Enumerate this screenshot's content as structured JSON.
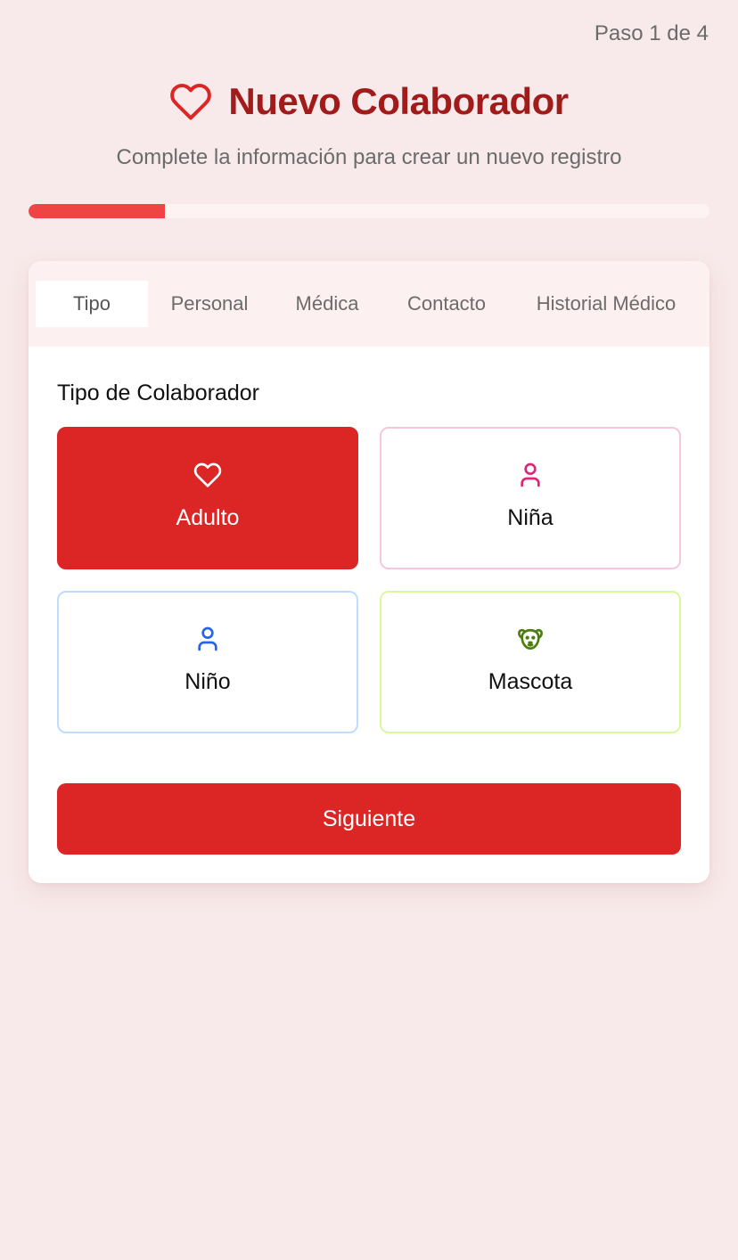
{
  "header": {
    "step_text": "Paso 1 de 4",
    "title": "Nuevo Colaborador",
    "subtitle": "Complete la información para crear un nuevo registro",
    "accent_color": "#a11b1b"
  },
  "progress": {
    "fraction": 0.2
  },
  "tabs": [
    {
      "label": "Tipo",
      "active": true
    },
    {
      "label": "Personal",
      "active": false
    },
    {
      "label": "Médica",
      "active": false
    },
    {
      "label": "Contacto",
      "active": false
    },
    {
      "label": "Historial Médico",
      "active": false
    }
  ],
  "form": {
    "section_label": "Tipo de Colaborador",
    "options": [
      {
        "label": "Adulto",
        "icon": "heart-icon",
        "selected": true,
        "color": "#ffffff"
      },
      {
        "label": "Niña",
        "icon": "user-icon",
        "selected": false,
        "color": "#db2777"
      },
      {
        "label": "Niño",
        "icon": "user-icon",
        "selected": false,
        "color": "#2563eb"
      },
      {
        "label": "Mascota",
        "icon": "dog-icon",
        "selected": false,
        "color": "#4d7c0f"
      }
    ],
    "next_label": "Siguiente",
    "primary_color": "#dc2626"
  }
}
